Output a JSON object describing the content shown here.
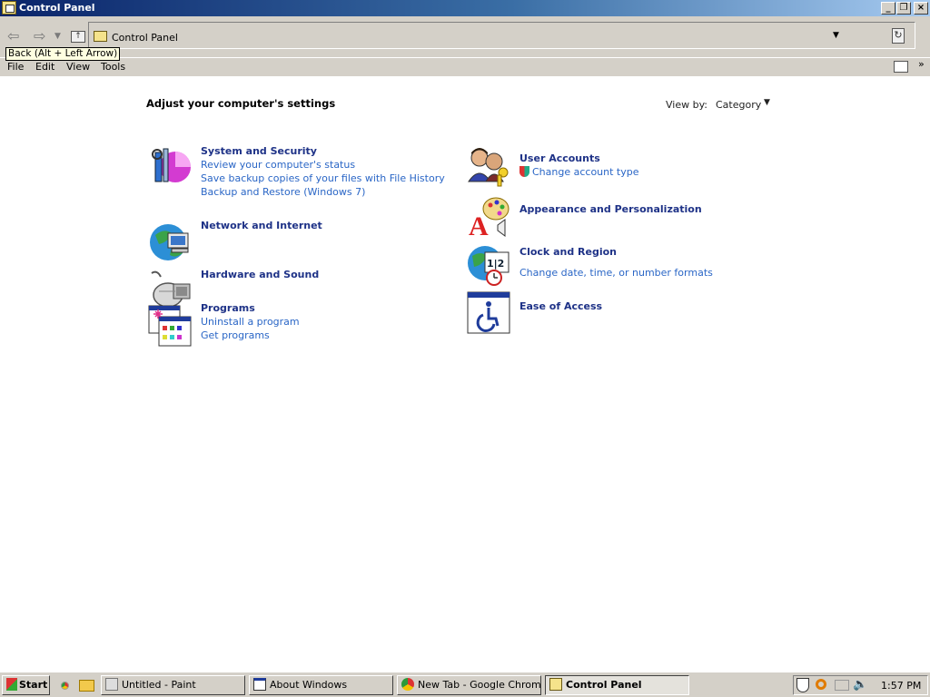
{
  "window": {
    "title": "Control Panel",
    "controls": {
      "minimize": "_",
      "restore": "❐",
      "close": "×"
    }
  },
  "toolbar": {
    "address": "Control Panel",
    "tooltip": "Back (Alt + Left Arrow)"
  },
  "menu": [
    "File",
    "Edit",
    "View",
    "Tools"
  ],
  "content": {
    "heading": "Adjust your computer's settings",
    "view_by_label": "View by:",
    "view_by_value": "Category",
    "categories_left": [
      {
        "title": "System and Security",
        "icon": "system-security-icon",
        "links": [
          "Review your computer's status",
          "Save backup copies of your files with File History",
          "Backup and Restore (Windows 7)"
        ]
      },
      {
        "title": "Network and Internet",
        "icon": "network-internet-icon",
        "links": []
      },
      {
        "title": "Hardware and Sound",
        "icon": "hardware-sound-icon",
        "links": []
      },
      {
        "title": "Programs",
        "icon": "programs-icon",
        "links": [
          "Uninstall a program",
          "Get programs"
        ]
      }
    ],
    "categories_right": [
      {
        "title": "User Accounts",
        "icon": "user-accounts-icon",
        "links": [
          "Change account type"
        ]
      },
      {
        "title": "Appearance and Personalization",
        "icon": "appearance-icon",
        "links": []
      },
      {
        "title": "Clock and Region",
        "icon": "clock-region-icon",
        "links": [
          "Change date, time, or number formats"
        ]
      },
      {
        "title": "Ease of Access",
        "icon": "ease-of-access-icon",
        "links": []
      }
    ]
  },
  "taskbar": {
    "start": "Start",
    "tasks": [
      "Untitled - Paint",
      "About Windows",
      "New Tab - Google Chrome",
      "Control Panel"
    ],
    "clock": "1:57 PM"
  },
  "colors": {
    "category_title": "#1e3287",
    "link": "#2a66c6",
    "chrome_gray": "#d4d0c8",
    "titlebar_start": "#0a246a"
  }
}
